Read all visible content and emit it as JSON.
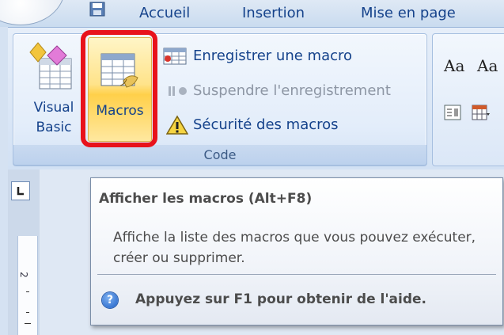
{
  "tabs": [
    "Accueil",
    "Insertion",
    "Mise en page"
  ],
  "code_group": {
    "label": "Code",
    "visual_basic": {
      "label_line1": "Visual",
      "label_line2": "Basic"
    },
    "macros": {
      "label": "Macros"
    },
    "commands": [
      {
        "label": "Enregistrer une macro",
        "icon": "record-macro-icon",
        "enabled": true
      },
      {
        "label": "Suspendre l'enregistrement",
        "icon": "pause-recording-icon",
        "enabled": false
      },
      {
        "label": "Sécurité des macros",
        "icon": "warning-icon",
        "enabled": true
      }
    ]
  },
  "styles_group": {
    "sample1": "Aa",
    "sample2": "Aa"
  },
  "ruler": {
    "number": "2"
  },
  "tooltip": {
    "title": "Afficher les macros (Alt+F8)",
    "body": "Affiche la liste des macros que vous pouvez exécuter, créer ou supprimer.",
    "help": "Appuyez sur F1 pour obtenir de l'aide.",
    "help_icon": "?"
  },
  "colors": {
    "highlight": "#e8121b",
    "ribbon_text": "#15428b",
    "tooltip_text": "#4c4c4c"
  }
}
